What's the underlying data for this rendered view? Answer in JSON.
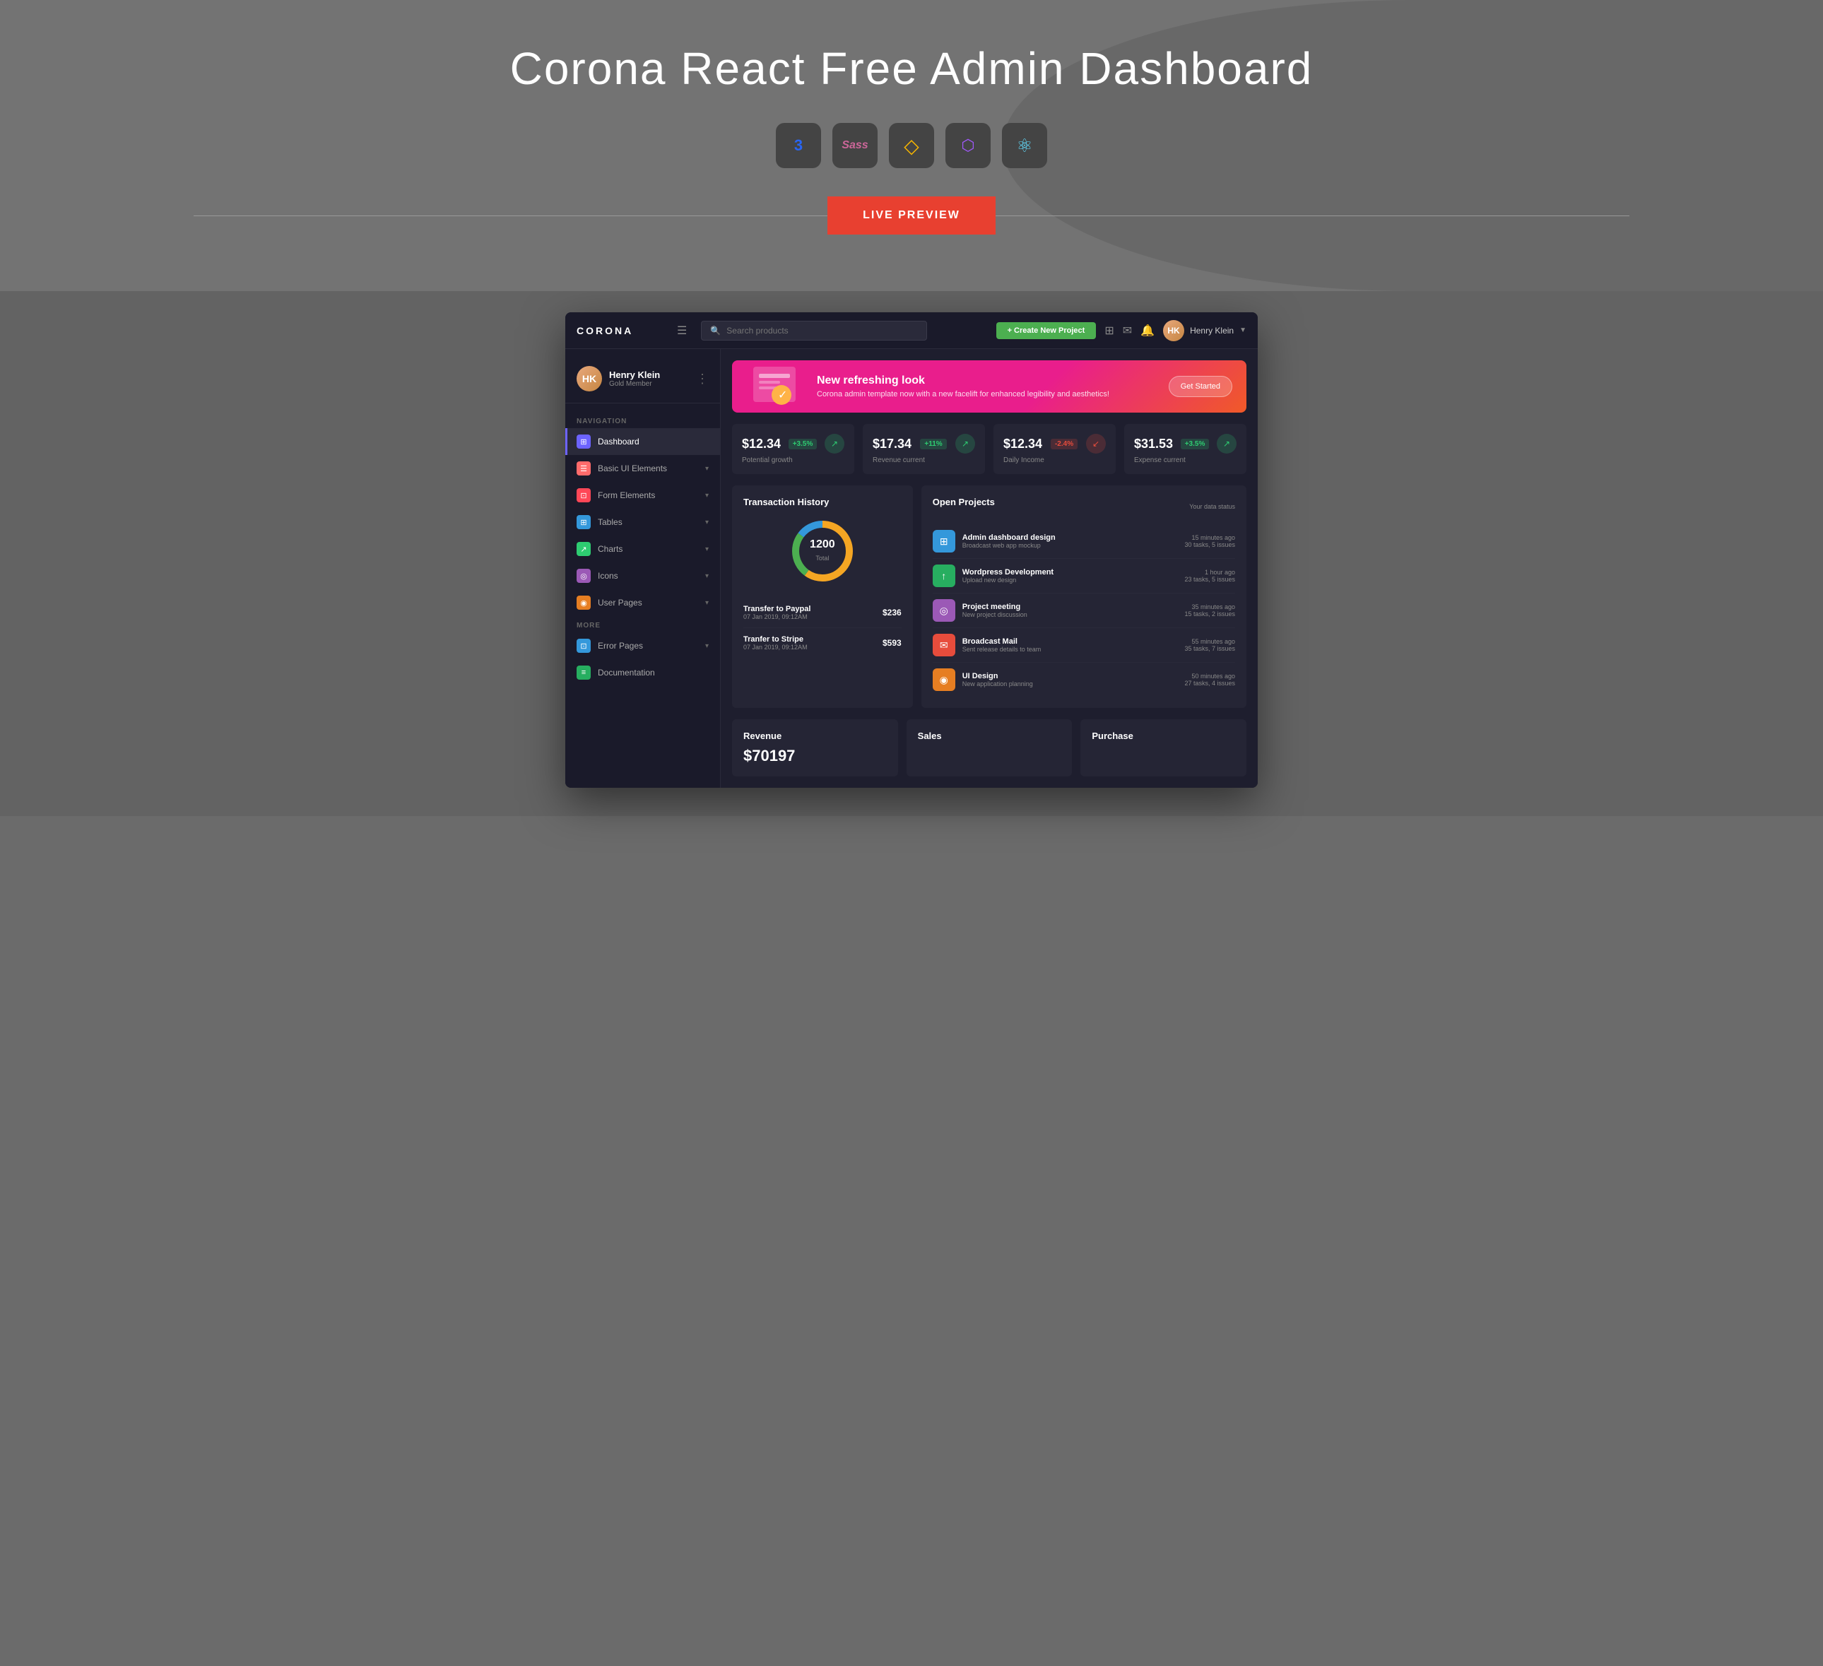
{
  "page": {
    "title": "Corona React Free Admin Dashboard"
  },
  "tech_icons": [
    {
      "name": "css3-icon",
      "symbol": "3",
      "class": "css",
      "label": "CSS3"
    },
    {
      "name": "sass-icon",
      "symbol": "Ss",
      "class": "sass",
      "label": "Sass"
    },
    {
      "name": "sketch-icon",
      "symbol": "✦",
      "class": "sketch",
      "label": "Sketch"
    },
    {
      "name": "figma-icon",
      "symbol": "▣",
      "class": "figma",
      "label": "Figma"
    },
    {
      "name": "react-icon",
      "symbol": "⚛",
      "class": "react",
      "label": "React"
    }
  ],
  "live_preview": {
    "label": "LIVE PREVIEW"
  },
  "navbar": {
    "logo": "CORONA",
    "search_placeholder": "Search products",
    "create_btn": "+ Create New Project",
    "user_name": "Henry Klein",
    "user_role": "Gold Member"
  },
  "sidebar": {
    "user": {
      "name": "Henry Klein",
      "role": "Gold Member"
    },
    "nav_label": "Navigation",
    "more_label": "More",
    "items": [
      {
        "id": "dashboard",
        "label": "Dashboard",
        "icon": "⊞",
        "icon_class": "icon-dashboard",
        "active": true
      },
      {
        "id": "basic-ui",
        "label": "Basic UI Elements",
        "icon": "☰",
        "icon_class": "icon-ui",
        "has_arrow": true
      },
      {
        "id": "form-elements",
        "label": "Form Elements",
        "icon": "⊡",
        "icon_class": "icon-form",
        "has_arrow": true
      },
      {
        "id": "tables",
        "label": "Tables",
        "icon": "⊞",
        "icon_class": "icon-table",
        "has_arrow": true
      },
      {
        "id": "charts",
        "label": "Charts",
        "icon": "↗",
        "icon_class": "icon-chart",
        "has_arrow": true
      },
      {
        "id": "icons",
        "label": "Icons",
        "icon": "◎",
        "icon_class": "icon-icons",
        "has_arrow": true
      },
      {
        "id": "user-pages",
        "label": "User Pages",
        "icon": "◉",
        "icon_class": "icon-pages",
        "has_arrow": true
      }
    ],
    "more_items": [
      {
        "id": "error-pages",
        "label": "Error Pages",
        "icon": "⊡",
        "icon_class": "icon-error",
        "has_arrow": true
      },
      {
        "id": "documentation",
        "label": "Documentation",
        "icon": "≡",
        "icon_class": "icon-doc"
      }
    ]
  },
  "banner": {
    "title": "New refreshing look",
    "description": "Corona admin template now with a new facelift for enhanced legibility and aesthetics!",
    "cta": "Get Started"
  },
  "stats": [
    {
      "value": "$12.34",
      "badge": "+3.5%",
      "badge_type": "green",
      "label": "Potential growth",
      "arrow": "↗",
      "arrow_type": "green"
    },
    {
      "value": "$17.34",
      "badge": "+11%",
      "badge_type": "green",
      "label": "Revenue current",
      "arrow": "↗",
      "arrow_type": "green"
    },
    {
      "value": "$12.34",
      "badge": "-2.4%",
      "badge_type": "red",
      "label": "Daily Income",
      "arrow": "↙",
      "arrow_type": "red"
    },
    {
      "value": "$31.53",
      "badge": "+3.5%",
      "badge_type": "green",
      "label": "Expense current",
      "arrow": "↗",
      "arrow_type": "green"
    }
  ],
  "transaction_history": {
    "title": "Transaction History",
    "donut": {
      "value": "1200",
      "label": "Total",
      "segments": [
        {
          "color": "#f5a623",
          "percent": 60
        },
        {
          "color": "#4caf50",
          "percent": 25
        },
        {
          "color": "#3498db",
          "percent": 15
        }
      ]
    },
    "items": [
      {
        "name": "Transfer to Paypal",
        "date": "07 Jan 2019, 09:12AM",
        "amount": "$236"
      },
      {
        "name": "Tranfer to Stripe",
        "date": "07 Jan 2019, 09:12AM",
        "amount": "$593"
      }
    ]
  },
  "open_projects": {
    "title": "Open Projects",
    "status_label": "Your data status",
    "items": [
      {
        "name": "Admin dashboard design",
        "desc": "Broadcast web app mockup",
        "time": "15 minutes ago",
        "tasks": "30 tasks, 5 issues",
        "icon_class": "pi-blue",
        "icon": "⊞"
      },
      {
        "name": "Wordpress Development",
        "desc": "Upload new design",
        "time": "1 hour ago",
        "tasks": "23 tasks, 5 issues",
        "icon_class": "pi-green",
        "icon": "↑"
      },
      {
        "name": "Project meeting",
        "desc": "New project discussion",
        "time": "35 minutes ago",
        "tasks": "15 tasks, 2 issues",
        "icon_class": "pi-purple",
        "icon": "◎"
      },
      {
        "name": "Broadcast Mail",
        "desc": "Sent release details to team",
        "time": "55 minutes ago",
        "tasks": "35 tasks, 7 issues",
        "icon_class": "pi-red",
        "icon": "✉"
      },
      {
        "name": "UI Design",
        "desc": "New application planning",
        "time": "50 minutes ago",
        "tasks": "27 tasks, 4 issues",
        "icon_class": "pi-orange",
        "icon": "◉"
      }
    ]
  },
  "bottom_panels": [
    {
      "id": "revenue",
      "title": "Revenue",
      "value": "$70197"
    },
    {
      "id": "sales",
      "title": "Sales",
      "value": ""
    },
    {
      "id": "purchase",
      "title": "Purchase",
      "value": ""
    }
  ]
}
